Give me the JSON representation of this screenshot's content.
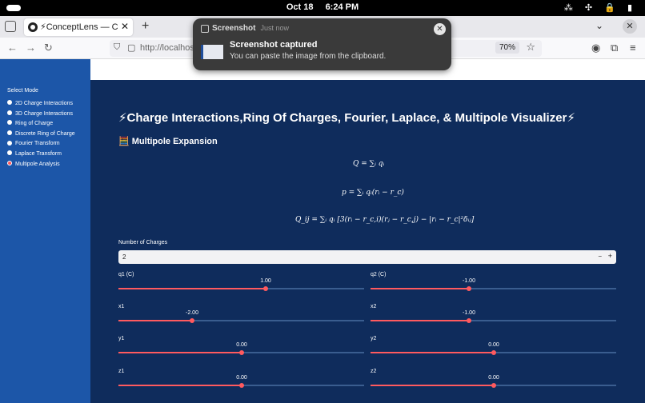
{
  "system": {
    "date": "Oct 18",
    "time": "6:24 PM",
    "tray": "⁂ ✣ 🔒 ▮"
  },
  "browser": {
    "tab_title": "⚡ConceptLens — Charg",
    "tab_close": "✕",
    "new_tab": "+",
    "url": "http://localhost",
    "zoom": "70%"
  },
  "toast": {
    "app": "Screenshot",
    "when": "Just now",
    "heading": "Screenshot captured",
    "message": "You can paste the image from the clipboard.",
    "close": "✕"
  },
  "sidebar": {
    "label": "Select Mode",
    "options": [
      "2D Charge Interactions",
      "3D Charge Interactions",
      "Ring of Charge",
      "Discrete Ring of Charge",
      "Fourier Transform",
      "Laplace Transform",
      "Multipole Analysis"
    ],
    "selected_index": 6
  },
  "main": {
    "title": "⚡Charge Interactions,Ring Of Charges, Fourier, Laplace, & Multipole Visualizer⚡",
    "subheading": "🧮 Multipole Expansion",
    "formulas": [
      "Q = ∑ᵢ qᵢ",
      "p = ∑ᵢ qᵢ(rᵢ − r_c)",
      "Q_ij = ∑ᵢ qᵢ [3(rᵢ − r_c,i)(rⱼ − r_c,j) − |rᵢ − r_c|²δᵢⱼ]"
    ],
    "num_charges": {
      "label": "Number of Charges",
      "value": "2",
      "minus": "−",
      "plus": "+"
    },
    "sliders": [
      {
        "label": "q1 (C)",
        "display": "1.00",
        "fraction": 0.6
      },
      {
        "label": "q2 (C)",
        "display": "-1.00",
        "fraction": 0.4
      },
      {
        "label": "x1",
        "display": "-2.00",
        "fraction": 0.3
      },
      {
        "label": "x2",
        "display": "-1.00",
        "fraction": 0.4
      },
      {
        "label": "y1",
        "display": "0.00",
        "fraction": 0.5
      },
      {
        "label": "y2",
        "display": "0.00",
        "fraction": 0.5
      },
      {
        "label": "z1",
        "display": "0.00",
        "fraction": 0.5
      },
      {
        "label": "z2",
        "display": "0.00",
        "fraction": 0.5
      }
    ]
  },
  "colors": {
    "accent": "#ff5a5f",
    "page_bg": "#0f2c5c",
    "sidebar_bg": "#1c56a8"
  }
}
